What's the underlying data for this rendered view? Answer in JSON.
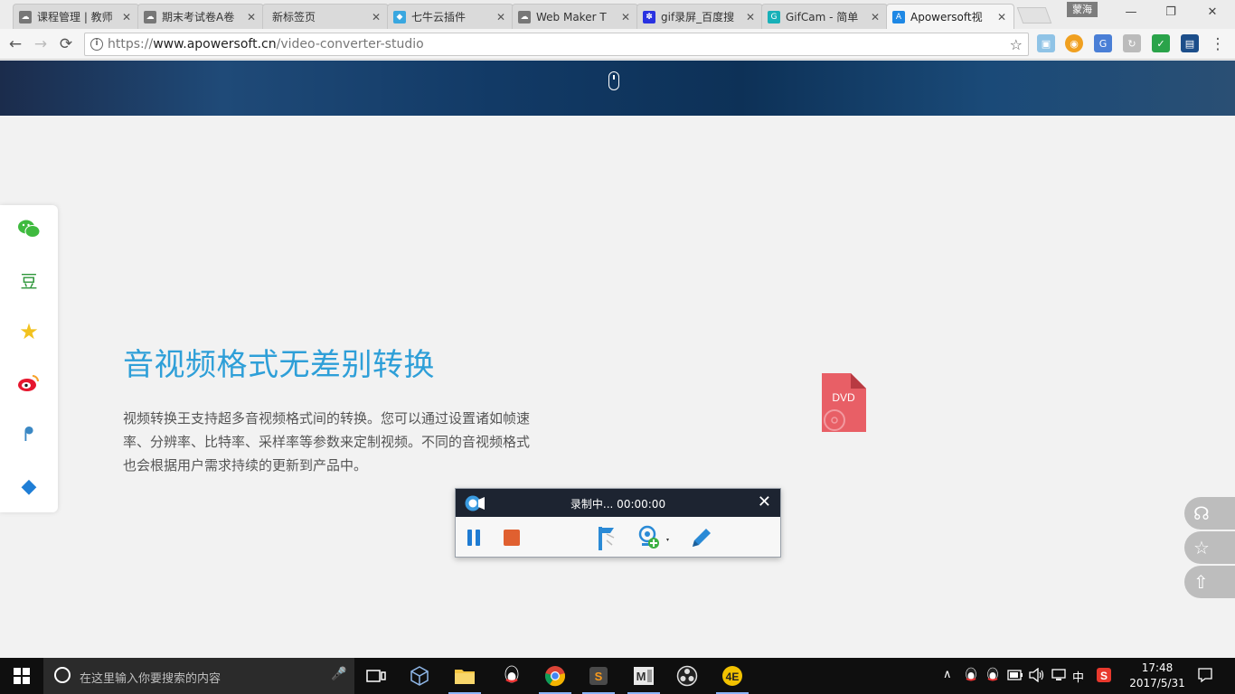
{
  "browser": {
    "tabs": [
      {
        "label": "课程管理 | 教师",
        "favicon": "cloud-icon",
        "color": "#666666"
      },
      {
        "label": "期末考试卷A卷",
        "favicon": "cloud-icon",
        "color": "#666666"
      },
      {
        "label": "新标签页",
        "favicon": "",
        "color": ""
      },
      {
        "label": "七牛云插件",
        "favicon": "qiniu-icon",
        "color": "#39a7e0"
      },
      {
        "label": "Web Maker T",
        "favicon": "cloud-icon",
        "color": "#666666"
      },
      {
        "label": "gif录屏_百度搜",
        "favicon": "baidu-paw-icon",
        "color": "#2932e1"
      },
      {
        "label": "GifCam - 简单",
        "favicon": "gifcam-icon",
        "color": "#17b0b8"
      },
      {
        "label": "Apowersoft视",
        "favicon": "apowersoft-icon",
        "color": "#1e88e5"
      }
    ],
    "tab_close": "✕",
    "profile_name": "蒙海",
    "window_controls": {
      "minimize": "—",
      "restore": "❐",
      "close": "✕"
    },
    "url_prefix": "https://",
    "url_host": "www.apowersoft.cn",
    "url_path": "/video-converter-studio",
    "nav": {
      "back": "←",
      "forward": "→",
      "reload": "⟳",
      "info": "i",
      "bookmark": "☆",
      "menu": "⋮"
    }
  },
  "page": {
    "hero_title": "音视频格式无差别转换",
    "hero_desc": "视频转换王支持超多音视频格式间的转换。您可以通过设置诸如帧速率、分辨率、比特率、采样率等参数来定制视频。不同的音视频格式也会根据用户需求持续的更新到产品中。",
    "dvd_label": "DVD",
    "share_items": [
      {
        "name": "wechat",
        "glyph": "●",
        "color": "#3fba3f"
      },
      {
        "name": "douban",
        "glyph": "豆",
        "color": "#2d963a"
      },
      {
        "name": "qzone",
        "glyph": "★",
        "color": "#f2c21f"
      },
      {
        "name": "weibo",
        "glyph": "◉",
        "color": "#e6162d"
      },
      {
        "name": "tencent-weibo",
        "glyph": "ᖰ",
        "color": "#3b88c4"
      },
      {
        "name": "more",
        "glyph": "◆",
        "color": "#1f7ed6"
      }
    ],
    "floaters": [
      {
        "name": "support",
        "glyph": "☊"
      },
      {
        "name": "favorite",
        "glyph": "☆"
      },
      {
        "name": "back-to-top",
        "glyph": "⇧"
      }
    ]
  },
  "recorder": {
    "status": "录制中... 00:00:00",
    "close": "✕"
  },
  "taskbar": {
    "search_placeholder": "在这里输入你要搜索的内容",
    "tray_ime": "中",
    "time": "17:48",
    "date": "2017/5/31",
    "caret": "∧"
  },
  "colors": {
    "accent": "#2e9fd8",
    "recorder_header": "#1d2431",
    "pause": "#1e7bd2",
    "stop": "#e06030",
    "dvd": "#e85f66"
  }
}
